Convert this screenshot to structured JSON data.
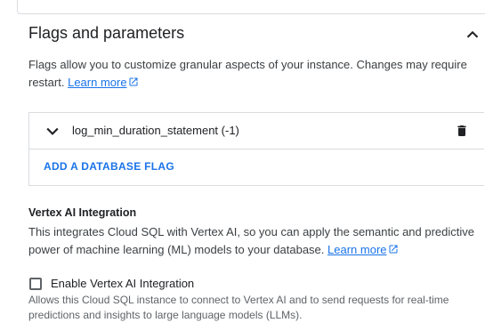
{
  "section": {
    "title": "Flags and parameters",
    "description": "Flags allow you to customize granular aspects of your instance. Changes may require restart.",
    "learn_more": "Learn more"
  },
  "flags": {
    "items": [
      {
        "label": "log_min_duration_statement (-1)"
      }
    ],
    "add_label": "ADD A DATABASE FLAG"
  },
  "vertex": {
    "title": "Vertex AI Integration",
    "description": "This integrates Cloud SQL with Vertex AI, so you can apply the semantic and predictive power of machine learning (ML) models to your database.",
    "learn_more": "Learn more",
    "checkbox_label": "Enable Vertex AI Integration",
    "checkbox_checked": false,
    "helper": "Allows this Cloud SQL instance to connect to Vertex AI and to send requests for real-time predictions and insights to large language models (LLMs)."
  },
  "colors": {
    "link": "#1a73e8",
    "border": "#dadce0",
    "text": "#202124"
  }
}
